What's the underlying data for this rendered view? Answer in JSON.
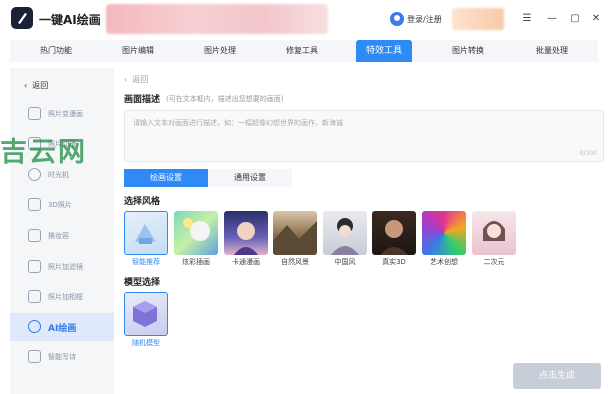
{
  "header": {
    "app_title": "一键AI绘画",
    "login_label": "登录/注册",
    "win_menu": "☰",
    "win_min": "—",
    "win_max": "▢",
    "win_close": "✕"
  },
  "tabs": [
    {
      "label": "热门功能"
    },
    {
      "label": "图片编辑"
    },
    {
      "label": "图片处理"
    },
    {
      "label": "修复工具"
    },
    {
      "label": "特效工具",
      "active": true
    },
    {
      "label": "图片转换"
    },
    {
      "label": "批量处理"
    }
  ],
  "sidebar": {
    "back_label": "返回",
    "items": [
      {
        "label": "照片变漫画"
      },
      {
        "label": "照片动漫"
      },
      {
        "label": "时光机"
      },
      {
        "label": "3D照片"
      },
      {
        "label": "换妆容"
      },
      {
        "label": "照片加滤镜"
      },
      {
        "label": "照片加相框"
      },
      {
        "label": "AI绘画",
        "active": true
      },
      {
        "label": "智能写诗"
      }
    ]
  },
  "watermark": "吉云网",
  "main": {
    "back_label": "返回",
    "describe_title": "画面描述",
    "describe_hint": "(可在文本框内，描述出您想要的画面)",
    "textarea_placeholder": "请输入文本对画面进行描述，如：一幅超像幻想世界的画作，新海诚",
    "textarea_count": "0/300",
    "settings_tabs": [
      "绘画设置",
      "通用设置"
    ],
    "style_title": "选择风格",
    "styles": [
      {
        "label": "智能推荐",
        "selected": true
      },
      {
        "label": "炫彩插画"
      },
      {
        "label": "卡通漫画"
      },
      {
        "label": "自然风景"
      },
      {
        "label": "中国风"
      },
      {
        "label": "真实3D"
      },
      {
        "label": "艺术创想"
      },
      {
        "label": "二次元"
      }
    ],
    "model_title": "模型选择",
    "models": [
      {
        "label": "随机模型",
        "selected": true
      }
    ],
    "generate_label": "点击生成"
  },
  "colors": {
    "accent": "#2f8af5",
    "sidebar_bg": "#f5f6f8",
    "disabled_button": "#c8ced8"
  }
}
